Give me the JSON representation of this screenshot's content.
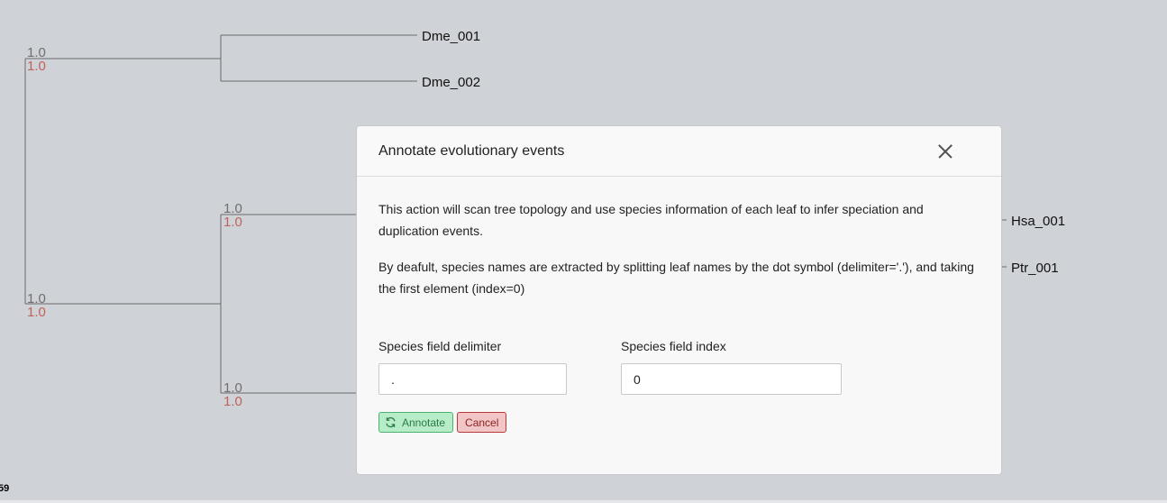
{
  "tree": {
    "support_values": {
      "root": [
        "1.0",
        "1.0"
      ],
      "node_upper": [
        "1.0",
        "1.0"
      ],
      "node_middle": [
        "1.0",
        "1.0"
      ],
      "node_lower": [
        "1.0",
        "1.0"
      ]
    },
    "leaves": {
      "dme1": "Dme_001",
      "dme2": "Dme_002",
      "hsa": "Hsa_001",
      "ptr": "Ptr_001"
    },
    "scale_value": "59"
  },
  "modal": {
    "title": "Annotate evolutionary events",
    "description_1": "This action will scan tree topology and use species information of each leaf to infer speciation and duplication events.",
    "description_2": "By deafult, species names are extracted by splitting leaf names by the dot symbol (delimiter='.'), and taking the first element (index=0)",
    "delimiter_label": "Species field delimiter",
    "delimiter_value": ".",
    "index_label": "Species field index",
    "index_value": "0",
    "annotate_label": "Annotate",
    "cancel_label": "Cancel",
    "close_icon": "close-icon",
    "annotate_icon": "refresh-icon"
  },
  "colors": {
    "background": "#cfd2d7",
    "branch": "#6b6b6b",
    "support_grey": "#6f6f6f",
    "support_red": "#c0635b",
    "annotate_bg": "#b7ecc9",
    "annotate_border": "#4bb36d",
    "cancel_bg": "#f2c6c6",
    "cancel_border": "#b63a3a"
  }
}
